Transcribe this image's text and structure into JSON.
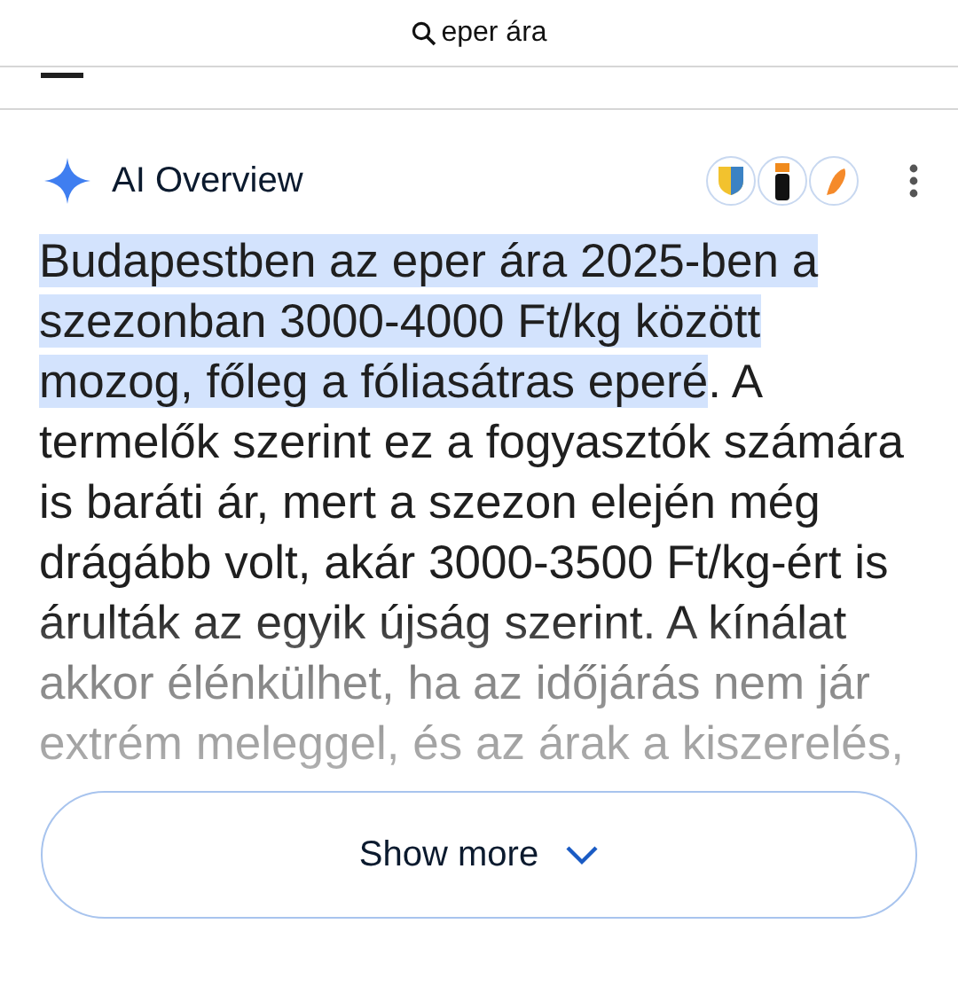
{
  "search_bar": {
    "query": "eper ára"
  },
  "overview": {
    "title": "AI Overview",
    "highlight": "Budapestben az eper ára 2025-ben a szezonban 3000-4000 Ft/kg között mozog, főleg a fóliasátras eperé",
    "rest": ". A termelők szerint ez a fogyasztók számára is baráti ár, mert a szezon elején még drágább volt, akár 3000-3500 Ft/kg-ért is árulták az egyik újság szerint. A kínálat akkor élénkülhet, ha az időjárás nem jár extrém meleggel, és az árak a kiszerelés,",
    "show_more": "Show more"
  }
}
